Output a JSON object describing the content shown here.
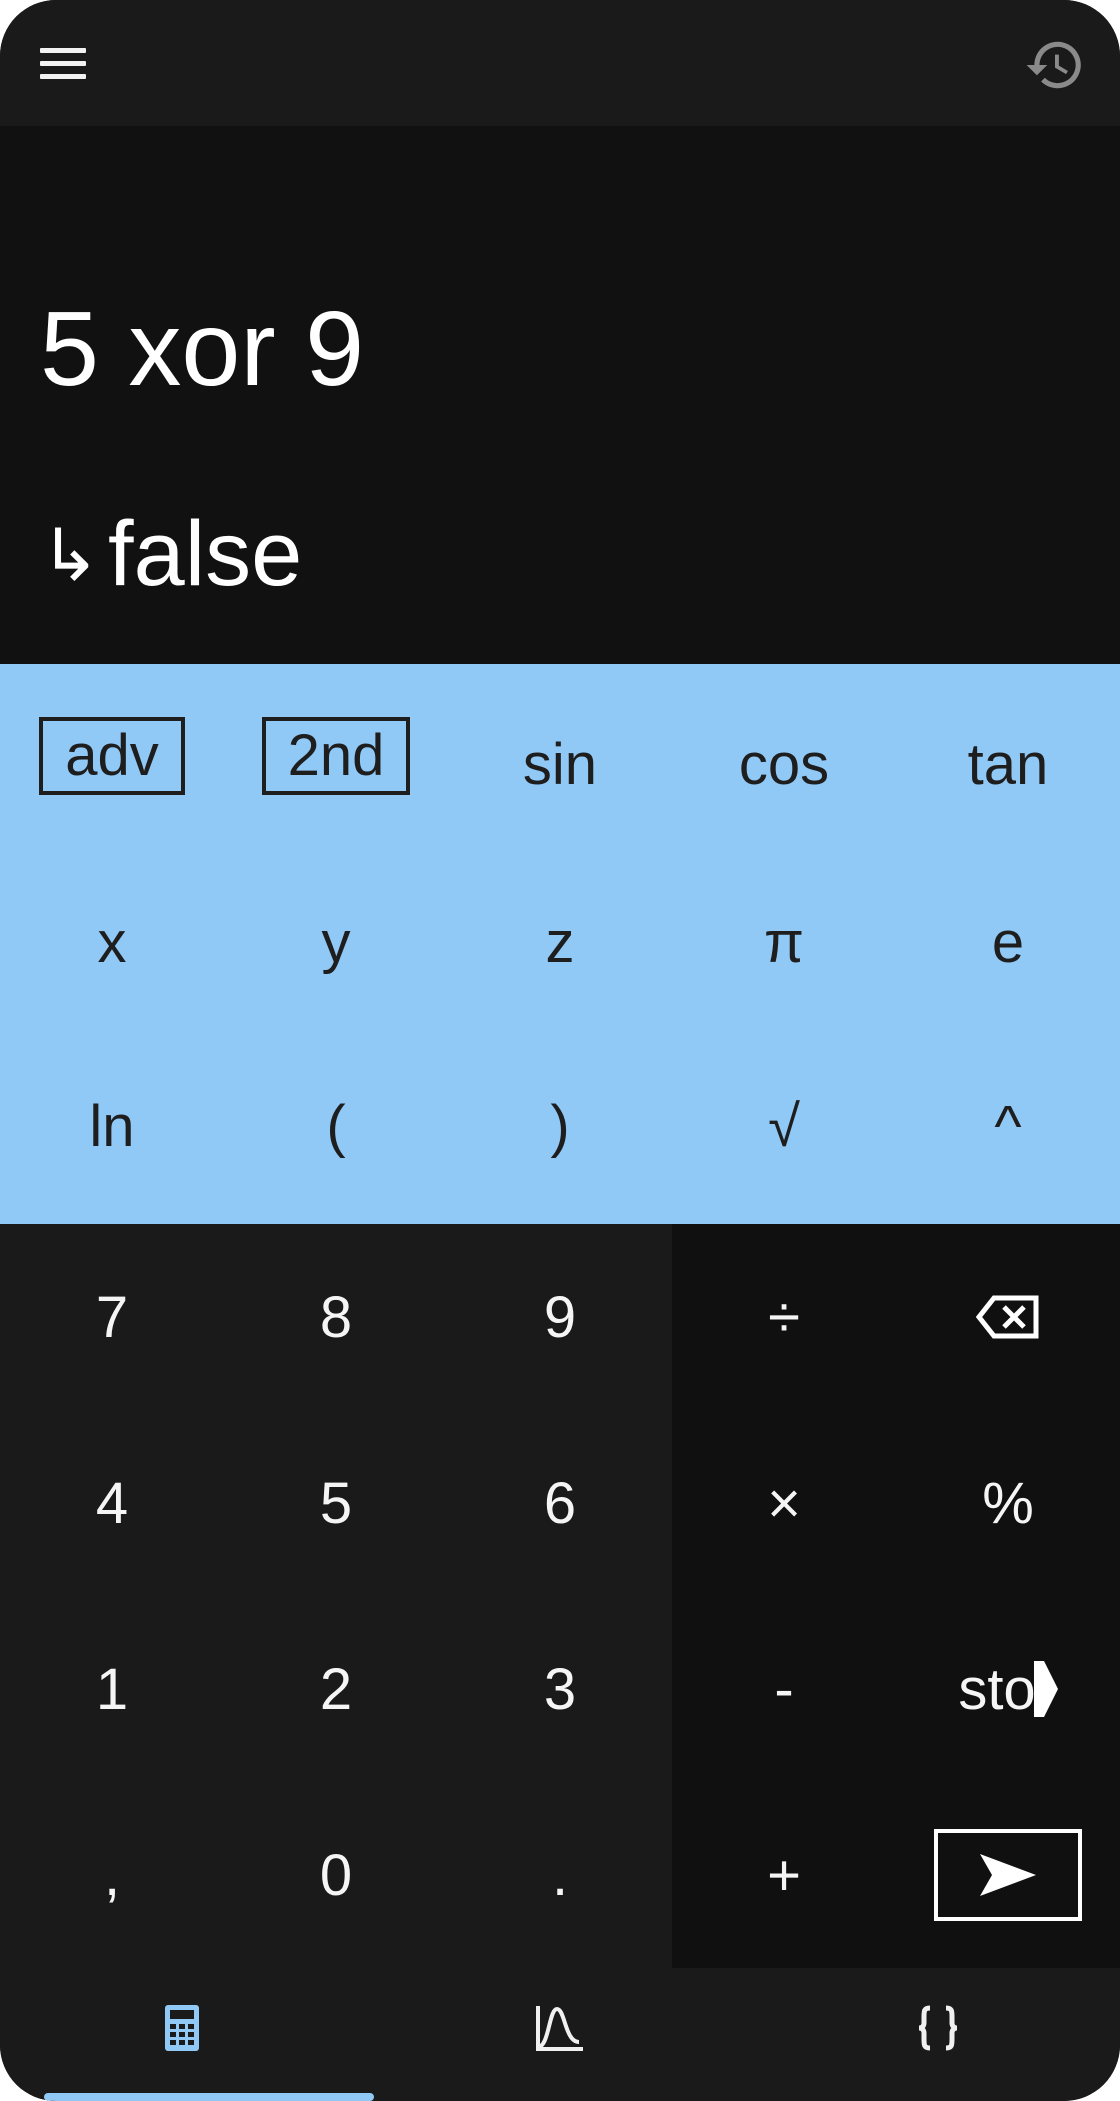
{
  "colors": {
    "accent": "#90c8f6",
    "display_bg": "#111111",
    "pad_bg": "#1a1a1b",
    "op_bg": "#101010"
  },
  "toolbar": {
    "menu_icon": "menu-icon",
    "history_icon": "history-icon"
  },
  "display": {
    "expression": "5 xor 9",
    "result_arrow": "↳",
    "result": "false"
  },
  "advanced_keys": {
    "row1": [
      "adv",
      "2nd",
      "sin",
      "cos",
      "tan"
    ],
    "row2": [
      "x",
      "y",
      "z",
      "π",
      "e"
    ],
    "row3": [
      "ln",
      "(",
      ")",
      "√",
      "^"
    ]
  },
  "number_keys": {
    "row1": [
      "7",
      "8",
      "9"
    ],
    "row2": [
      "4",
      "5",
      "6"
    ],
    "row3": [
      "1",
      "2",
      "3"
    ],
    "row4": [
      ",",
      "0",
      "."
    ]
  },
  "operator_keys": {
    "divide": "÷",
    "backspace_icon": "backspace-icon",
    "multiply": "×",
    "percent": "%",
    "minus": "-",
    "store": "sto",
    "plus": "+",
    "enter_icon": "enter-arrow-icon"
  },
  "bottom_nav": {
    "items": [
      {
        "name": "calculator",
        "icon": "calculator-icon",
        "active": true
      },
      {
        "name": "graph",
        "icon": "graph-icon",
        "active": false
      },
      {
        "name": "code",
        "icon": "braces-icon",
        "active": false
      }
    ]
  }
}
